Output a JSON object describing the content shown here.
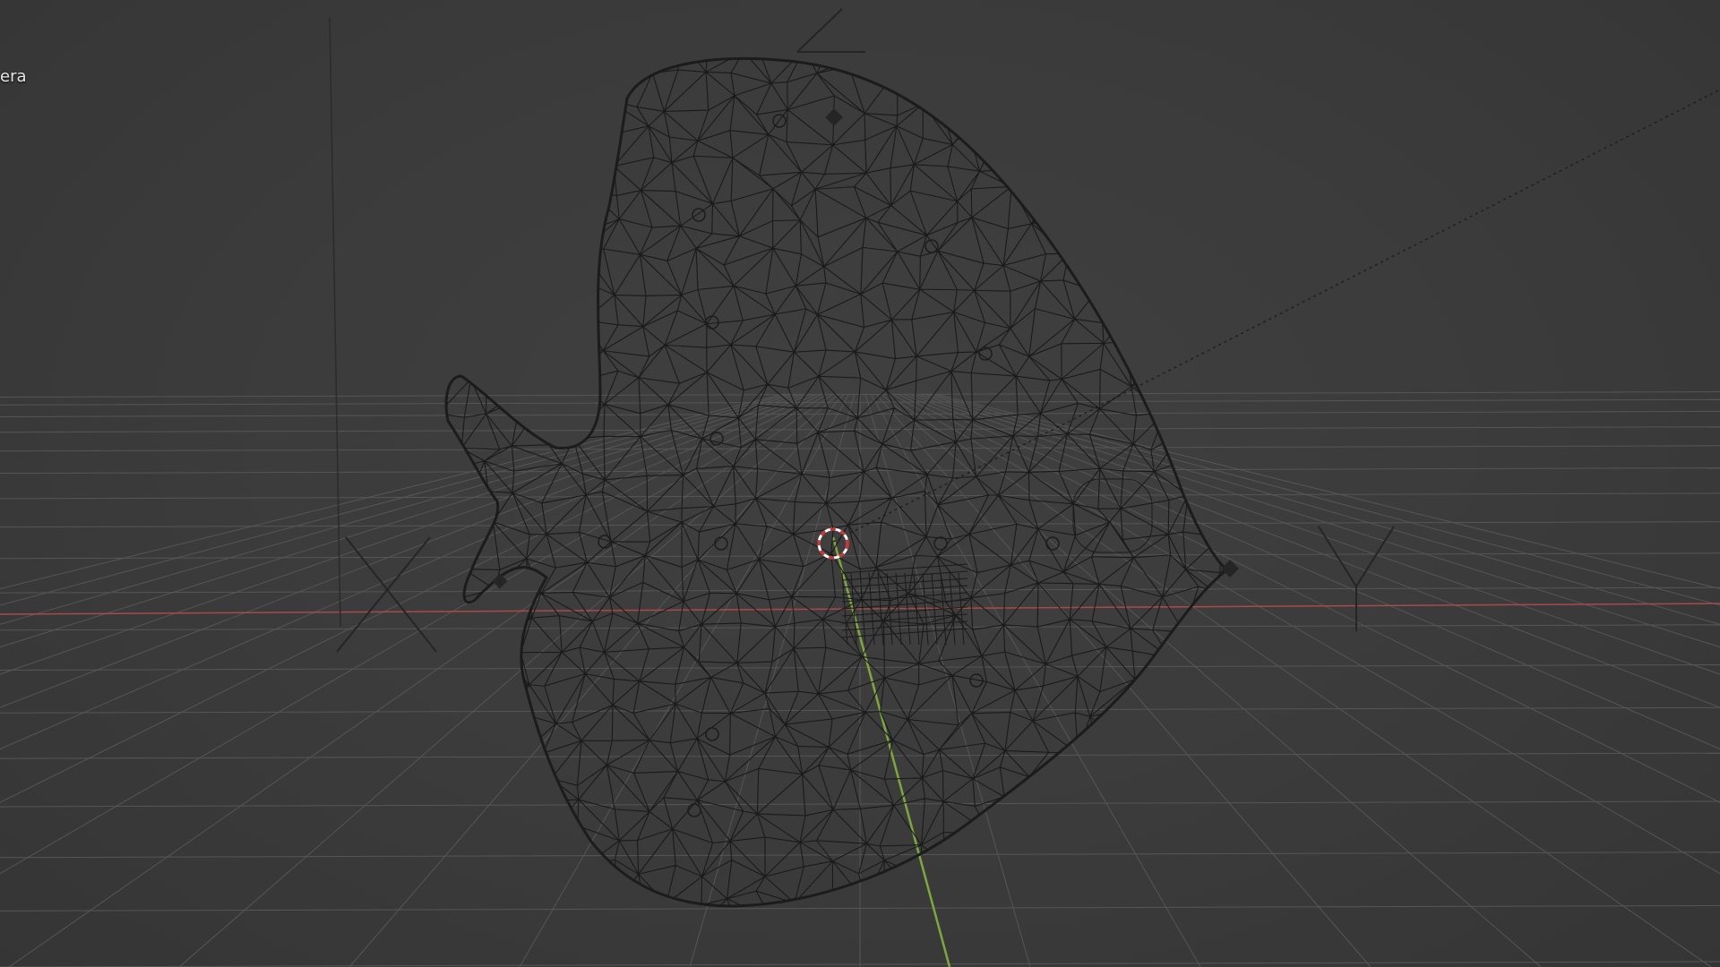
{
  "viewport": {
    "label": "era",
    "shading": "wireframe",
    "background_color": "#3a3a3a"
  },
  "scene": {
    "object": "fish-mesh",
    "axis_letters": {
      "x": "X",
      "y": "Y",
      "z": "Z"
    },
    "colors": {
      "grid": "#565656",
      "x_axis": "#a84a4a",
      "y_axis": "#7ea83a",
      "wire": "#1a1a1a",
      "cursor_red": "#d83030",
      "cursor_white": "#ffffff"
    }
  }
}
